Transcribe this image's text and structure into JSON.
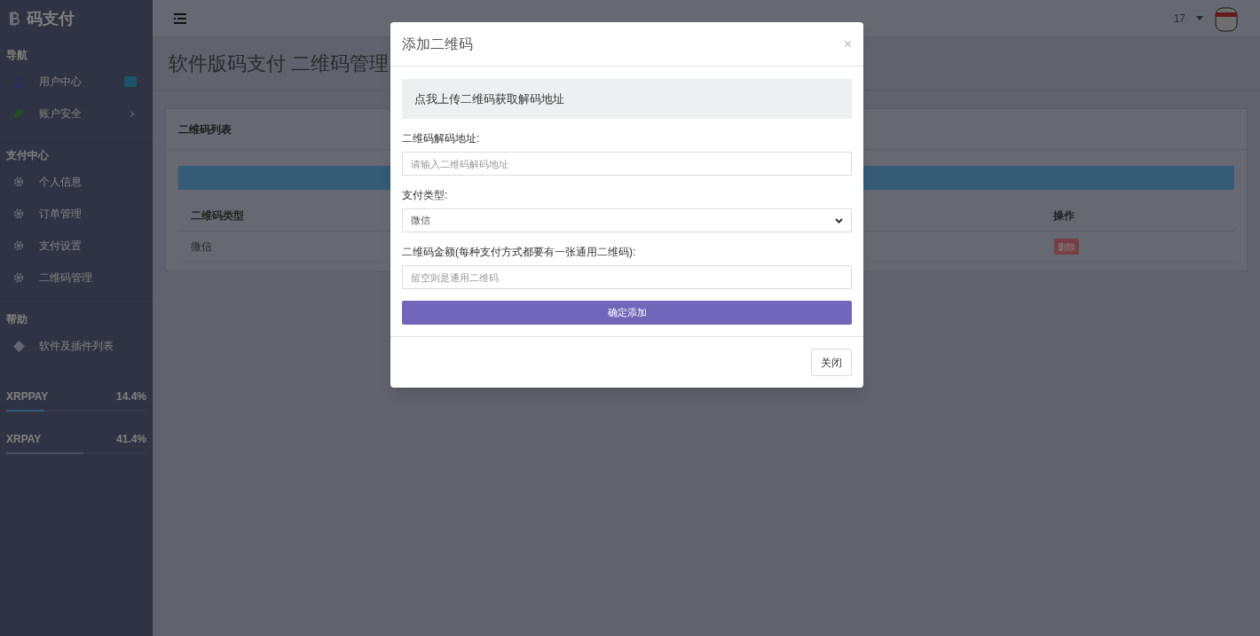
{
  "sidebar": {
    "brand": "码支付",
    "sections": [
      {
        "title": "导航",
        "items": [
          {
            "label": "用户中心",
            "kind": "user",
            "badge": true,
            "chevron": false
          },
          {
            "label": "账户安全",
            "kind": "security",
            "badge": false,
            "chevron": true
          }
        ]
      },
      {
        "title": "支付中心",
        "items": [
          {
            "label": "个人信息",
            "kind": "setting",
            "badge": false,
            "chevron": false
          },
          {
            "label": "订单管理",
            "kind": "setting",
            "badge": false,
            "chevron": false
          },
          {
            "label": "支付设置",
            "kind": "setting",
            "badge": false,
            "chevron": false
          },
          {
            "label": "二维码管理",
            "kind": "setting",
            "badge": false,
            "chevron": false
          }
        ]
      },
      {
        "title": "帮助",
        "items": [
          {
            "label": "软件及插件列表",
            "kind": "plugin",
            "badge": false,
            "chevron": false
          }
        ]
      }
    ],
    "meters": [
      {
        "name": "XRPPAY",
        "reading": "14.4%",
        "level": 0.27
      },
      {
        "name": "XRPAY",
        "reading": "41.4%",
        "level": 0.55
      }
    ]
  },
  "topbar": {
    "user": "17"
  },
  "page_title": "软件版码支付 二维码管理",
  "panel": {
    "title": "二维码列表",
    "table": {
      "columns": [
        "二维码类型",
        "操作"
      ],
      "rows": [
        {
          "type": "微信",
          "action": "删除"
        }
      ]
    }
  },
  "modal": {
    "title": "添加二维码",
    "close": "×",
    "upload": "点我上传二维码获取解码地址",
    "fields": [
      {
        "kind": "input",
        "label": "二维码解码地址:",
        "placeholder": "请输入二维码解码地址"
      },
      {
        "kind": "select",
        "label": "支付类型:",
        "value": "微信"
      },
      {
        "kind": "input",
        "label": "二维码金额(每种支付方式都要有一张通用二维码):",
        "placeholder": "留空则是通用二维码"
      }
    ],
    "submit": "确定添加",
    "dismiss": "关闭"
  }
}
